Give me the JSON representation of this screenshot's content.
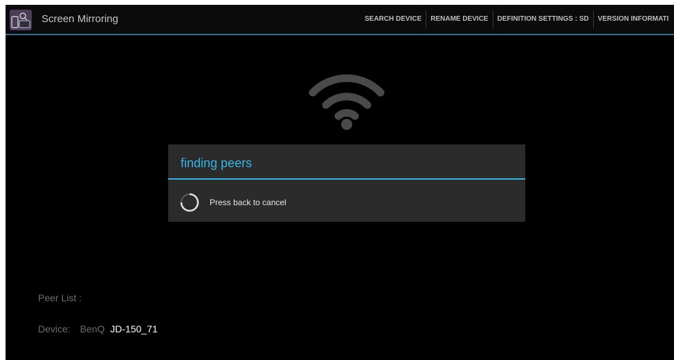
{
  "app": {
    "title": "Screen Mirroring",
    "icon": "screen-mirroring-app-icon"
  },
  "menu": {
    "search_device": "SEARCH DEVICE",
    "rename_device": "RENAME DEVICE",
    "definition_settings": "DEFINITION SETTINGS : SD",
    "version_information": "VERSION INFORMATI"
  },
  "status_icon": "wifi-icon",
  "dialog": {
    "title": "finding peers",
    "message": "Press back to cancel",
    "accent_color": "#33b5e5"
  },
  "peers": {
    "label": "Peer List :",
    "device_label": "Device:",
    "device_brand": "BenQ",
    "device_model": "JD-150_71"
  },
  "colors": {
    "background": "#000000",
    "accent": "#33b5e5",
    "dialog": "#2b2b2b"
  }
}
